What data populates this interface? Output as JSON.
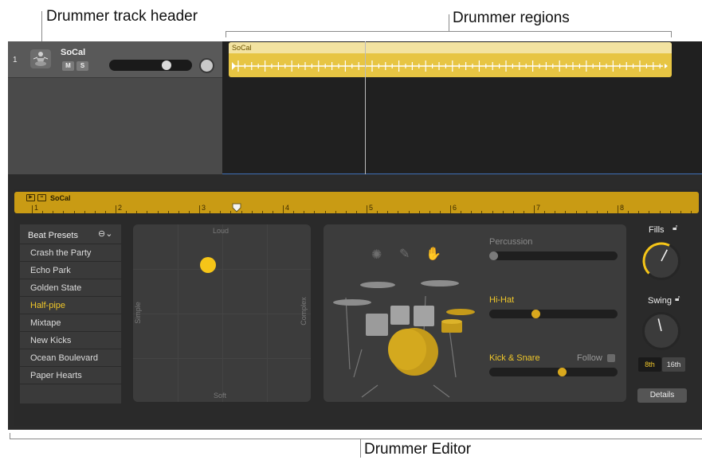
{
  "callouts": {
    "track_header": "Drummer track header",
    "regions": "Drummer regions",
    "editor": "Drummer Editor"
  },
  "track": {
    "number": "1",
    "name": "SoCal",
    "mute_label": "M",
    "solo_label": "S",
    "volume_level": 0.65
  },
  "region": {
    "name": "SoCal"
  },
  "ruler": {
    "title": "SoCal",
    "bars": [
      "1",
      "2",
      "3",
      "4",
      "5",
      "6",
      "7",
      "8"
    ]
  },
  "presets": {
    "title": "Beat Presets",
    "menu_icon": "ellipsis-circle-icon",
    "items": [
      {
        "label": "Crash the Party",
        "active": false
      },
      {
        "label": "Echo Park",
        "active": false
      },
      {
        "label": "Golden State",
        "active": false
      },
      {
        "label": "Half-pipe",
        "active": true
      },
      {
        "label": "Mixtape",
        "active": false
      },
      {
        "label": "New Kicks",
        "active": false
      },
      {
        "label": "Ocean Boulevard",
        "active": false
      },
      {
        "label": "Paper Hearts",
        "active": false
      }
    ]
  },
  "xy_pad": {
    "top_label": "Loud",
    "bottom_label": "Soft",
    "left_label": "Simple",
    "right_label": "Complex",
    "puck": {
      "complexity": 0.42,
      "loudness": 0.77
    }
  },
  "kit": {
    "percussion_label": "Percussion",
    "percussion_value": 0.0,
    "hihat_label": "Hi-Hat",
    "hihat_value": 0.35,
    "kick_snare_label": "Kick & Snare",
    "kick_snare_value": 0.57,
    "follow_label": "Follow",
    "icons": [
      "tambourine-icon",
      "shaker-icon",
      "clap-icon"
    ],
    "accent_color": "#f0c72a",
    "inactive_color": "#8a8a8a"
  },
  "controls": {
    "fills_label": "Fills",
    "fills_value": 0.6,
    "swing_label": "Swing",
    "swing_value": 0.45,
    "eighth_label": "8th",
    "sixteenth_label": "16th",
    "selected_division": "8th",
    "details_label": "Details"
  }
}
